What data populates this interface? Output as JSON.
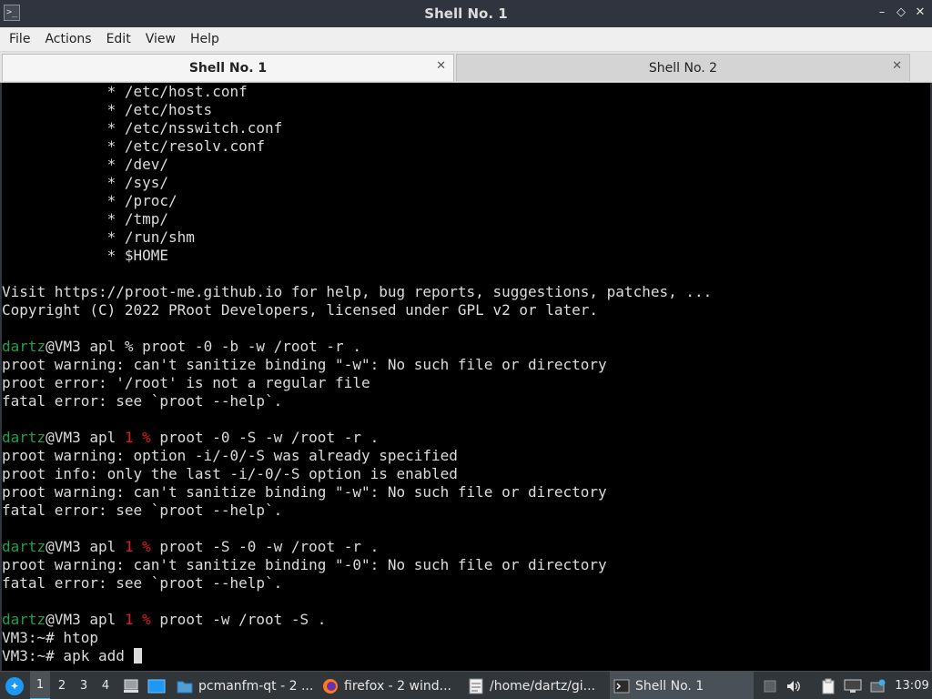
{
  "window": {
    "title": "Shell No. 1",
    "minimize_glyph": "–",
    "restore_glyph": "◇",
    "close_glyph": "✕",
    "app_icon_glyph": ">_"
  },
  "menu": [
    "File",
    "Actions",
    "Edit",
    "View",
    "Help"
  ],
  "tabs": [
    {
      "label": "Shell No. 1",
      "active": true
    },
    {
      "label": "Shell No. 2",
      "active": false
    }
  ],
  "tab_close_glyph": "✕",
  "terminal": {
    "lines": [
      {
        "segments": [
          {
            "t": "            * /etc/host.conf"
          }
        ]
      },
      {
        "segments": [
          {
            "t": "            * /etc/hosts"
          }
        ]
      },
      {
        "segments": [
          {
            "t": "            * /etc/nsswitch.conf"
          }
        ]
      },
      {
        "segments": [
          {
            "t": "            * /etc/resolv.conf"
          }
        ]
      },
      {
        "segments": [
          {
            "t": "            * /dev/"
          }
        ]
      },
      {
        "segments": [
          {
            "t": "            * /sys/"
          }
        ]
      },
      {
        "segments": [
          {
            "t": "            * /proc/"
          }
        ]
      },
      {
        "segments": [
          {
            "t": "            * /tmp/"
          }
        ]
      },
      {
        "segments": [
          {
            "t": "            * /run/shm"
          }
        ]
      },
      {
        "segments": [
          {
            "t": "            * $HOME"
          }
        ]
      },
      {
        "segments": [
          {
            "t": ""
          }
        ]
      },
      {
        "segments": [
          {
            "t": "Visit https://proot-me.github.io for help, bug reports, suggestions, patches, ..."
          }
        ]
      },
      {
        "segments": [
          {
            "t": "Copyright (C) 2022 PRoot Developers, licensed under GPL v2 or later."
          }
        ]
      },
      {
        "segments": [
          {
            "t": ""
          }
        ]
      },
      {
        "segments": [
          {
            "t": "dartz",
            "c": "user"
          },
          {
            "t": "@VM3 apl % proot -0 -b -w /root -r ."
          }
        ]
      },
      {
        "segments": [
          {
            "t": "proot warning: can't sanitize binding \"-w\": No such file or directory"
          }
        ]
      },
      {
        "segments": [
          {
            "t": "proot error: '/root' is not a regular file"
          }
        ]
      },
      {
        "segments": [
          {
            "t": "fatal error: see `proot --help`."
          }
        ]
      },
      {
        "segments": [
          {
            "t": ""
          }
        ]
      },
      {
        "segments": [
          {
            "t": "dartz",
            "c": "user"
          },
          {
            "t": "@VM3 apl "
          },
          {
            "t": "1 %",
            "c": "red"
          },
          {
            "t": " proot -0 -S -w /root -r ."
          }
        ]
      },
      {
        "segments": [
          {
            "t": "proot warning: option -i/-0/-S was already specified"
          }
        ]
      },
      {
        "segments": [
          {
            "t": "proot info: only the last -i/-0/-S option is enabled"
          }
        ]
      },
      {
        "segments": [
          {
            "t": "proot warning: can't sanitize binding \"-w\": No such file or directory"
          }
        ]
      },
      {
        "segments": [
          {
            "t": "fatal error: see `proot --help`."
          }
        ]
      },
      {
        "segments": [
          {
            "t": ""
          }
        ]
      },
      {
        "segments": [
          {
            "t": "dartz",
            "c": "user"
          },
          {
            "t": "@VM3 apl "
          },
          {
            "t": "1 %",
            "c": "red"
          },
          {
            "t": " proot -S -0 -w /root -r ."
          }
        ]
      },
      {
        "segments": [
          {
            "t": "proot warning: can't sanitize binding \"-0\": No such file or directory"
          }
        ]
      },
      {
        "segments": [
          {
            "t": "fatal error: see `proot --help`."
          }
        ]
      },
      {
        "segments": [
          {
            "t": ""
          }
        ]
      },
      {
        "segments": [
          {
            "t": "dartz",
            "c": "user"
          },
          {
            "t": "@VM3 apl "
          },
          {
            "t": "1 %",
            "c": "red"
          },
          {
            "t": " proot -w /root -S ."
          }
        ]
      },
      {
        "segments": [
          {
            "t": "VM3:~# htop"
          }
        ]
      },
      {
        "segments": [
          {
            "t": "VM3:~# apk add "
          }
        ],
        "cursor": true
      }
    ]
  },
  "taskbar": {
    "desktops": [
      "1",
      "2",
      "3",
      "4"
    ],
    "active_desktop": "1",
    "tasks": [
      {
        "label": "pcmanfm-qt - 2 ...",
        "icon": "folder-icon"
      },
      {
        "label": "firefox - 2 wind...",
        "icon": "firefox-icon"
      },
      {
        "label": "/home/dartz/gi...",
        "icon": "text-editor-icon"
      },
      {
        "label": "Shell No. 1",
        "icon": "terminal-icon",
        "active": true
      }
    ],
    "clock": "13:09"
  },
  "colors": {
    "user": "#1fa14a",
    "error_status": "#e01b24",
    "accent": "#3daee9"
  }
}
